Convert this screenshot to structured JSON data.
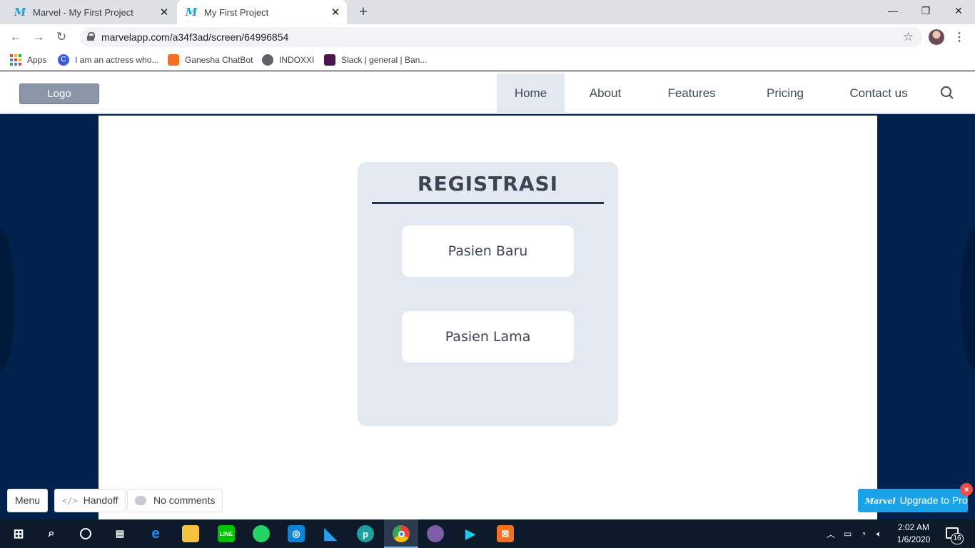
{
  "browser": {
    "tabs": [
      {
        "title": "Marvel - My First Project",
        "active": false
      },
      {
        "title": "My First Project",
        "active": true
      }
    ],
    "url": "marvelapp.com/a34f3ad/screen/64996854",
    "bookmarks": [
      {
        "label": "Apps",
        "icon": "apps-grid-icon"
      },
      {
        "label": "I am an actress who...",
        "icon": "c-logo-icon"
      },
      {
        "label": "Ganesha ChatBot",
        "icon": "xampp-icon"
      },
      {
        "label": "INDOXXI",
        "icon": "globe-icon"
      },
      {
        "label": "Slack | general | Ban...",
        "icon": "slack-icon"
      }
    ]
  },
  "site": {
    "logo": "Logo",
    "nav": [
      {
        "label": "Home",
        "active": true
      },
      {
        "label": "About",
        "active": false
      },
      {
        "label": "Features",
        "active": false
      },
      {
        "label": "Pricing",
        "active": false
      },
      {
        "label": "Contact us",
        "active": false
      }
    ]
  },
  "card": {
    "title": "REGISTRASI",
    "buttons": [
      "Pasien Baru",
      "Pasien Lama"
    ]
  },
  "marvel": {
    "menu": "Menu",
    "handoff": "Handoff",
    "comments": "No comments",
    "upgrade": "Upgrade to Pro",
    "upgrade_logo": "Marvel"
  },
  "taskbar": {
    "time": "2:02 AM",
    "date": "1/6/2020",
    "notifications": "16"
  },
  "colors": {
    "background": "#00224d",
    "accent": "#1aa3e8",
    "card": "#e4e8f0"
  }
}
